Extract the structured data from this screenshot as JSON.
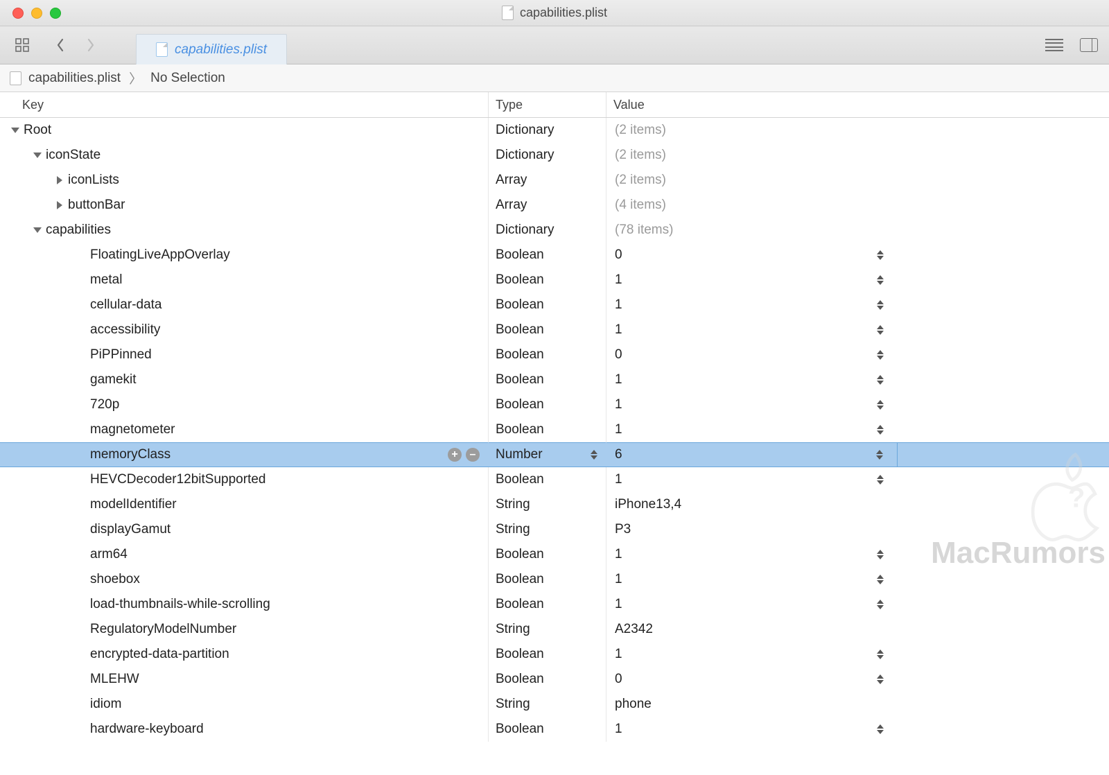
{
  "window": {
    "title": "capabilities.plist"
  },
  "tab": {
    "filename": "capabilities.plist"
  },
  "breadcrumb": {
    "file": "capabilities.plist",
    "selection": "No Selection"
  },
  "columns": {
    "key": "Key",
    "type": "Type",
    "value": "Value"
  },
  "watermark": "MacRumors",
  "rows": [
    {
      "key": "Root",
      "type": "Dictionary",
      "value": "(2 items)",
      "indent": 0,
      "disclosure": "down",
      "muted": true,
      "stepper": false,
      "selected": false,
      "plusminus": false
    },
    {
      "key": "iconState",
      "type": "Dictionary",
      "value": "(2 items)",
      "indent": 1,
      "disclosure": "down",
      "muted": true,
      "stepper": false,
      "selected": false,
      "plusminus": false
    },
    {
      "key": "iconLists",
      "type": "Array",
      "value": "(2 items)",
      "indent": 2,
      "disclosure": "right",
      "muted": true,
      "stepper": false,
      "selected": false,
      "plusminus": false
    },
    {
      "key": "buttonBar",
      "type": "Array",
      "value": "(4 items)",
      "indent": 2,
      "disclosure": "right",
      "muted": true,
      "stepper": false,
      "selected": false,
      "plusminus": false
    },
    {
      "key": "capabilities",
      "type": "Dictionary",
      "value": "(78 items)",
      "indent": 1,
      "disclosure": "down",
      "muted": true,
      "stepper": false,
      "selected": false,
      "plusminus": false
    },
    {
      "key": "FloatingLiveAppOverlay",
      "type": "Boolean",
      "value": "0",
      "indent": 3,
      "disclosure": "none",
      "muted": false,
      "stepper": true,
      "selected": false,
      "plusminus": false
    },
    {
      "key": "metal",
      "type": "Boolean",
      "value": "1",
      "indent": 3,
      "disclosure": "none",
      "muted": false,
      "stepper": true,
      "selected": false,
      "plusminus": false
    },
    {
      "key": "cellular-data",
      "type": "Boolean",
      "value": "1",
      "indent": 3,
      "disclosure": "none",
      "muted": false,
      "stepper": true,
      "selected": false,
      "plusminus": false
    },
    {
      "key": "accessibility",
      "type": "Boolean",
      "value": "1",
      "indent": 3,
      "disclosure": "none",
      "muted": false,
      "stepper": true,
      "selected": false,
      "plusminus": false
    },
    {
      "key": "PiPPinned",
      "type": "Boolean",
      "value": "0",
      "indent": 3,
      "disclosure": "none",
      "muted": false,
      "stepper": true,
      "selected": false,
      "plusminus": false
    },
    {
      "key": "gamekit",
      "type": "Boolean",
      "value": "1",
      "indent": 3,
      "disclosure": "none",
      "muted": false,
      "stepper": true,
      "selected": false,
      "plusminus": false
    },
    {
      "key": "720p",
      "type": "Boolean",
      "value": "1",
      "indent": 3,
      "disclosure": "none",
      "muted": false,
      "stepper": true,
      "selected": false,
      "plusminus": false
    },
    {
      "key": "magnetometer",
      "type": "Boolean",
      "value": "1",
      "indent": 3,
      "disclosure": "none",
      "muted": false,
      "stepper": true,
      "selected": false,
      "plusminus": false
    },
    {
      "key": "memoryClass",
      "type": "Number",
      "value": "6",
      "indent": 3,
      "disclosure": "none",
      "muted": false,
      "stepper": true,
      "selected": true,
      "plusminus": true,
      "typeStepper": true
    },
    {
      "key": "HEVCDecoder12bitSupported",
      "type": "Boolean",
      "value": "1",
      "indent": 3,
      "disclosure": "none",
      "muted": false,
      "stepper": true,
      "selected": false,
      "plusminus": false
    },
    {
      "key": "modelIdentifier",
      "type": "String",
      "value": "iPhone13,4",
      "indent": 3,
      "disclosure": "none",
      "muted": false,
      "stepper": false,
      "selected": false,
      "plusminus": false
    },
    {
      "key": "displayGamut",
      "type": "String",
      "value": "P3",
      "indent": 3,
      "disclosure": "none",
      "muted": false,
      "stepper": false,
      "selected": false,
      "plusminus": false
    },
    {
      "key": "arm64",
      "type": "Boolean",
      "value": "1",
      "indent": 3,
      "disclosure": "none",
      "muted": false,
      "stepper": true,
      "selected": false,
      "plusminus": false
    },
    {
      "key": "shoebox",
      "type": "Boolean",
      "value": "1",
      "indent": 3,
      "disclosure": "none",
      "muted": false,
      "stepper": true,
      "selected": false,
      "plusminus": false
    },
    {
      "key": "load-thumbnails-while-scrolling",
      "type": "Boolean",
      "value": "1",
      "indent": 3,
      "disclosure": "none",
      "muted": false,
      "stepper": true,
      "selected": false,
      "plusminus": false
    },
    {
      "key": "RegulatoryModelNumber",
      "type": "String",
      "value": "A2342",
      "indent": 3,
      "disclosure": "none",
      "muted": false,
      "stepper": false,
      "selected": false,
      "plusminus": false
    },
    {
      "key": "encrypted-data-partition",
      "type": "Boolean",
      "value": "1",
      "indent": 3,
      "disclosure": "none",
      "muted": false,
      "stepper": true,
      "selected": false,
      "plusminus": false
    },
    {
      "key": "MLEHW",
      "type": "Boolean",
      "value": "0",
      "indent": 3,
      "disclosure": "none",
      "muted": false,
      "stepper": true,
      "selected": false,
      "plusminus": false
    },
    {
      "key": "idiom",
      "type": "String",
      "value": "phone",
      "indent": 3,
      "disclosure": "none",
      "muted": false,
      "stepper": false,
      "selected": false,
      "plusminus": false
    },
    {
      "key": "hardware-keyboard",
      "type": "Boolean",
      "value": "1",
      "indent": 3,
      "disclosure": "none",
      "muted": false,
      "stepper": true,
      "selected": false,
      "plusminus": false
    }
  ]
}
